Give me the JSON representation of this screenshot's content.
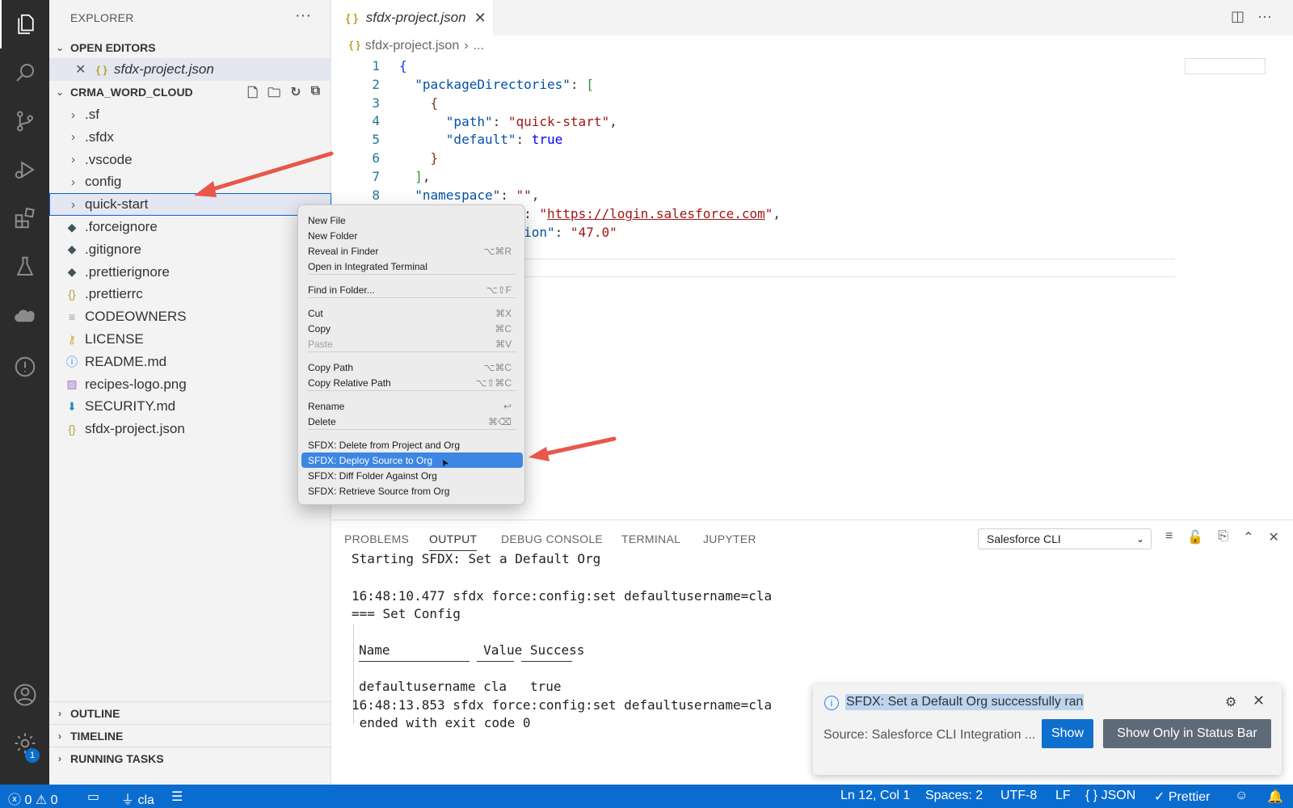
{
  "sidebar": {
    "title": "EXPLORER",
    "open_editors_label": "OPEN EDITORS",
    "open_editor_file": "sfdx-project.json",
    "project_label": "CRMA_WORD_CLOUD",
    "items": [
      {
        "label": ".sf",
        "kind": "folder"
      },
      {
        "label": ".sfdx",
        "kind": "folder"
      },
      {
        "label": ".vscode",
        "kind": "folder"
      },
      {
        "label": "config",
        "kind": "folder"
      },
      {
        "label": "quick-start",
        "kind": "folder"
      },
      {
        "label": ".forceignore",
        "kind": "git"
      },
      {
        "label": ".gitignore",
        "kind": "git"
      },
      {
        "label": ".prettierignore",
        "kind": "git"
      },
      {
        "label": ".prettierrc",
        "kind": "json"
      },
      {
        "label": "CODEOWNERS",
        "kind": "text"
      },
      {
        "label": "LICENSE",
        "kind": "license"
      },
      {
        "label": "README.md",
        "kind": "info"
      },
      {
        "label": "recipes-logo.png",
        "kind": "image"
      },
      {
        "label": "SECURITY.md",
        "kind": "md"
      },
      {
        "label": "sfdx-project.json",
        "kind": "json"
      }
    ],
    "bottom_sections": [
      "OUTLINE",
      "TIMELINE",
      "RUNNING TASKS"
    ]
  },
  "editor": {
    "tab_title": "sfdx-project.json",
    "breadcrumb": [
      "sfdx-project.json",
      "›",
      "..."
    ],
    "line_numbers": [
      "1",
      "2",
      "3",
      "4",
      "5",
      "6",
      "7",
      "8"
    ]
  },
  "context_menu": {
    "items": [
      {
        "label": "New File",
        "shortcut": ""
      },
      {
        "label": "New Folder",
        "shortcut": ""
      },
      {
        "label": "Reveal in Finder",
        "shortcut": "⌥⌘R"
      },
      {
        "label": "Open in Integrated Terminal",
        "shortcut": ""
      },
      {
        "label": "Find in Folder...",
        "shortcut": "⌥⇧F"
      },
      {
        "label": "Cut",
        "shortcut": "⌘X"
      },
      {
        "label": "Copy",
        "shortcut": "⌘C"
      },
      {
        "label": "Paste",
        "shortcut": "⌘V"
      },
      {
        "label": "Copy Path",
        "shortcut": "⌥⌘C"
      },
      {
        "label": "Copy Relative Path",
        "shortcut": "⌥⇧⌘C"
      },
      {
        "label": "Rename",
        "shortcut": "↩"
      },
      {
        "label": "Delete",
        "shortcut": "⌘⌫"
      },
      {
        "label": "SFDX: Delete from Project and Org",
        "shortcut": ""
      },
      {
        "label": "SFDX: Deploy Source to Org",
        "shortcut": ""
      },
      {
        "label": "SFDX: Diff Folder Against Org",
        "shortcut": ""
      },
      {
        "label": "SFDX: Retrieve Source from Org",
        "shortcut": ""
      }
    ]
  },
  "panel": {
    "tabs": [
      "PROBLEMS",
      "OUTPUT",
      "DEBUG CONSOLE",
      "TERMINAL",
      "JUPYTER"
    ],
    "active_tab": "OUTPUT",
    "channel": "Salesforce CLI",
    "output_lines": [
      "Starting SFDX: Set a Default Org",
      "16:48:10.477 sfdx force:config:set defaultusername=cla",
      "=== Set Config",
      "Name            Value Success",
      "defaultusername cla   true",
      "16:48:13.853 sfdx force:config:set defaultusername=cla",
      " ended with exit code 0"
    ]
  },
  "notification": {
    "message": "SFDX: Set a Default Org successfully ran",
    "source": "Source: Salesforce CLI Integration ...",
    "show_label": "Show",
    "show_status_label": "Show Only in Status Bar"
  },
  "status_bar": {
    "errors": "0",
    "warnings": "0",
    "org": "cla",
    "position": "Ln 12, Col 1",
    "spaces": "Spaces: 2",
    "encoding": "UTF-8",
    "eol": "LF",
    "language": "JSON",
    "formatter": "Prettier"
  },
  "activity_bar": {
    "settings_badge": "1",
    "icons": [
      "files-icon",
      "search-icon",
      "source-control-icon",
      "run-debug-icon",
      "extensions-icon",
      "testing-icon",
      "salesforce-cloud-icon",
      "problems-icon",
      "account-icon",
      "settings-gear-icon"
    ]
  },
  "colors": {
    "status_bar": "#0a6ccf",
    "activity_bar": "#2c2c2c",
    "menu_highlight": "#3d86e3",
    "annotation_arrow": "#e8574a"
  }
}
